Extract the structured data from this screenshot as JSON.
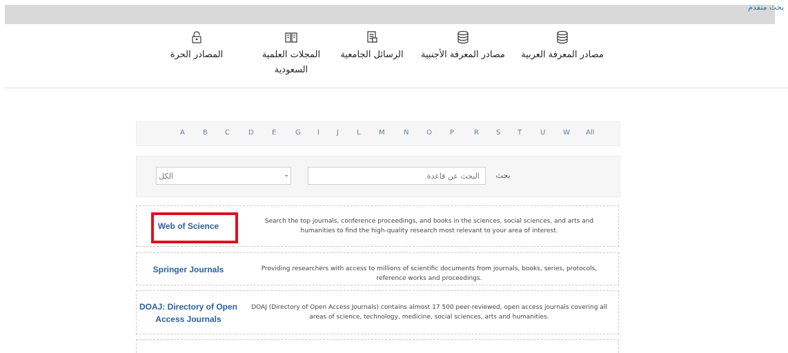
{
  "top_bar": {
    "advanced_search": "بحث متقدم"
  },
  "categories": [
    {
      "label": "مصادر المعرفة العربية",
      "icon": "database-icon"
    },
    {
      "label": "مصادر المعرفة الأجنبية",
      "icon": "database-icon"
    },
    {
      "label": "الرسائل الجامعية",
      "icon": "document-icon"
    },
    {
      "label": "المجلات العلمية السعودية",
      "icon": "book-icon"
    },
    {
      "label": "المصادر الحرة",
      "icon": "open-lock-icon"
    }
  ],
  "alphabet": [
    "A",
    "B",
    "C",
    "D",
    "E",
    "G",
    "I",
    "J",
    "L",
    "M",
    "N",
    "O",
    "P",
    "R",
    "S",
    "T",
    "U",
    "W",
    "All"
  ],
  "search": {
    "select_value": "الكل",
    "placeholder": "البحث عن قاعدة",
    "button_label": "بحث"
  },
  "databases": [
    {
      "name": "Web of Science",
      "description": "Search the top journals, conference proceedings, and books in the sciences, social sciences, and arts and humanities to find the high-quality research most relevant to your area of interest."
    },
    {
      "name": "Springer Journals",
      "description": "Providing researchers with access to millions of scientific documents from journals, books, series, protocols, reference works and proceedings."
    },
    {
      "name": "DOAJ: Directory of Open Access Journals",
      "description": "DOAJ (Directory of Open Access Journals) contains almost 17 500 peer-reviewed, open access journals covering all areas of science, technology, medicine, social sciences, arts and humanities."
    }
  ],
  "colors": {
    "highlight": "#e0101e",
    "link": "#2a5f9e",
    "top_bar": "#d9d9d9"
  }
}
